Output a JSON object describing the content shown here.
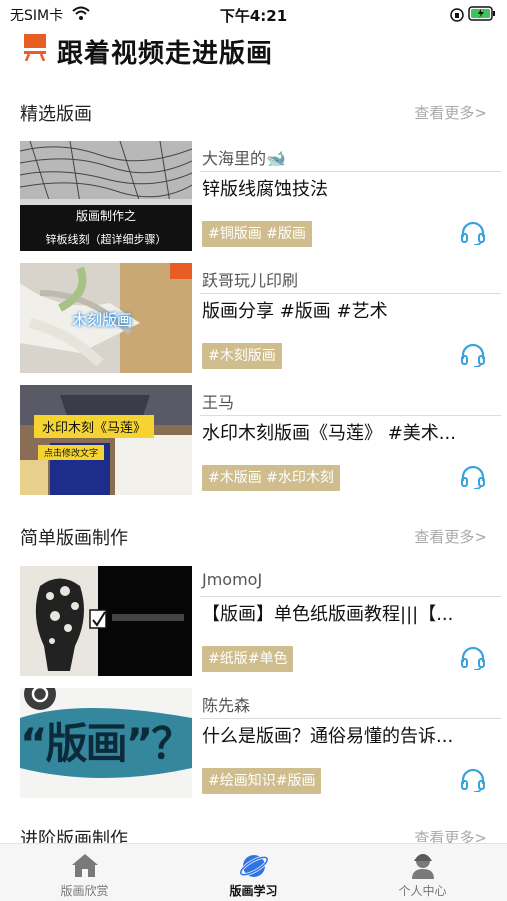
{
  "status_bar": {
    "carrier": "无SIM卡",
    "time": "下午4:21"
  },
  "header": {
    "title": "跟着视频走进版画"
  },
  "sections": [
    {
      "title": "精选版画",
      "more": "查看更多>",
      "items": [
        {
          "author": "大海里的🐋",
          "title": "锌版线腐蚀技法",
          "tags": "#铜版画 #版画",
          "thumb_caption_1": "版画制作之",
          "thumb_caption_2": "锌板线刻（超详细步骤）"
        },
        {
          "author": "跃哥玩儿印刷",
          "title": "版画分享 #版画 #艺术",
          "tags": "#木刻版画",
          "thumb_caption_1": "木刻版画"
        },
        {
          "author": "王马",
          "title": "水印木刻版画《马莲》 #美术...",
          "tags": "#木版画 #水印木刻",
          "thumb_caption_1": "水印木刻《马莲》",
          "thumb_caption_2": "点击修改文字"
        }
      ]
    },
    {
      "title": "简单版画制作",
      "more": "查看更多>",
      "items": [
        {
          "author": "JmomoJ",
          "title": "【版画】单色纸版画教程|||【...",
          "tags": "#纸版#单色"
        },
        {
          "author": "陈先森",
          "title": "什么是版画？通俗易懂的告诉...",
          "tags": "#绘画知识#版画",
          "thumb_caption_1": "“版画”？"
        }
      ]
    },
    {
      "title": "进阶版画制作",
      "more": "查看更多>"
    }
  ],
  "tab_bar": {
    "tabs": [
      {
        "label": "版画欣赏"
      },
      {
        "label": "版画学习"
      },
      {
        "label": "个人中心"
      }
    ]
  },
  "colors": {
    "tag_bg": "#cfbd8e",
    "audio_icon": "#3aa3dd",
    "active_tab": "#2f74e6",
    "logo": "#e85d24"
  }
}
